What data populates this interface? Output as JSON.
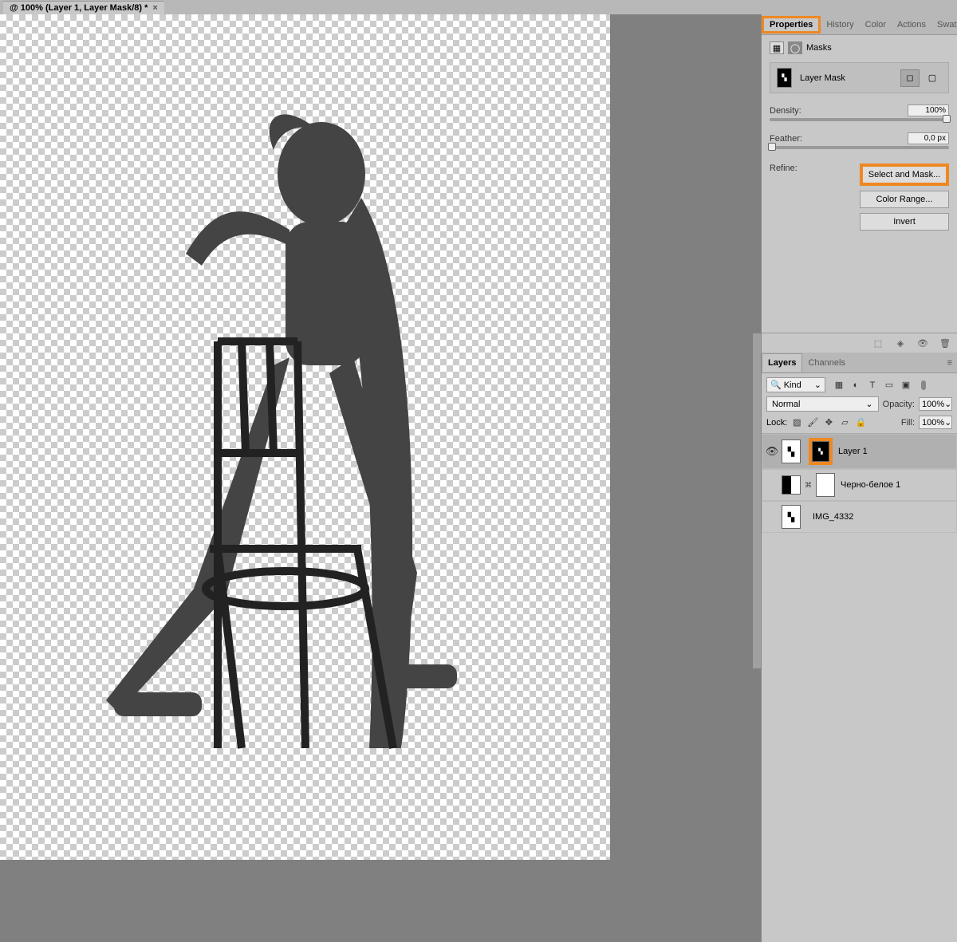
{
  "tab": {
    "title": "@ 100% (Layer 1, Layer Mask/8) *"
  },
  "panels": {
    "tabs": [
      "Properties",
      "History",
      "Color",
      "Actions",
      "Swatches"
    ],
    "activeTab": "Properties"
  },
  "masksPanel": {
    "title": "Masks",
    "typeLabel": "Layer Mask",
    "density": {
      "label": "Density:",
      "value": "100%"
    },
    "feather": {
      "label": "Feather:",
      "value": "0,0 px"
    },
    "refine": {
      "label": "Refine:",
      "buttons": [
        "Select and Mask...",
        "Color Range...",
        "Invert"
      ]
    }
  },
  "layersPanel": {
    "tabs": [
      "Layers",
      "Channels"
    ],
    "activeTab": "Layers",
    "kindLabel": "Kind",
    "blendMode": "Normal",
    "opacityLabel": "Opacity:",
    "opacityValue": "100%",
    "lockLabel": "Lock:",
    "fillLabel": "Fill:",
    "fillValue": "100%",
    "layers": [
      {
        "name": "Layer 1",
        "visible": true,
        "selected": true,
        "hasMask": true
      },
      {
        "name": "Черно-белое 1",
        "visible": false,
        "selected": false,
        "hasMask": true,
        "isAdjustment": true
      },
      {
        "name": "IMG_4332",
        "visible": false,
        "selected": false,
        "hasMask": false
      }
    ]
  }
}
